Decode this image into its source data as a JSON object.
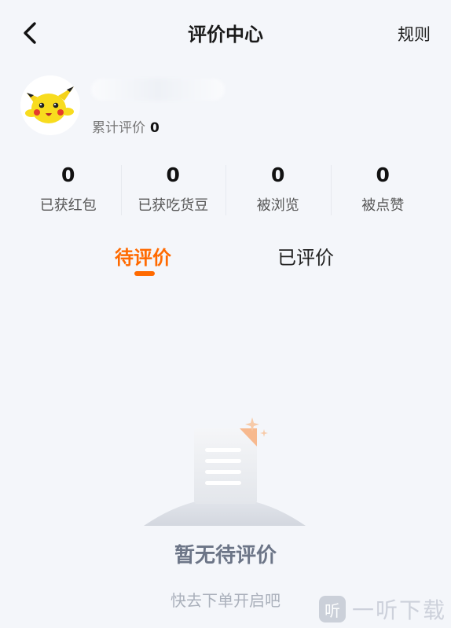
{
  "header": {
    "title": "评价中心",
    "rules_label": "规则",
    "back_icon": "chevron-left-icon"
  },
  "profile": {
    "total_label": "累计评价",
    "total_value": "0"
  },
  "stats": [
    {
      "value": "0",
      "label": "已获红包"
    },
    {
      "value": "0",
      "label": "已获吃货豆"
    },
    {
      "value": "0",
      "label": "被浏览"
    },
    {
      "value": "0",
      "label": "被点赞"
    }
  ],
  "tabs": [
    {
      "label": "待评价",
      "active": true
    },
    {
      "label": "已评价",
      "active": false
    }
  ],
  "empty": {
    "title": "暂无待评价",
    "subtitle": "快去下单开启吧"
  },
  "watermark": {
    "logo_char": "听",
    "text": "一听下载"
  },
  "colors": {
    "accent": "#ff6a00",
    "background": "#f4f6fa"
  }
}
